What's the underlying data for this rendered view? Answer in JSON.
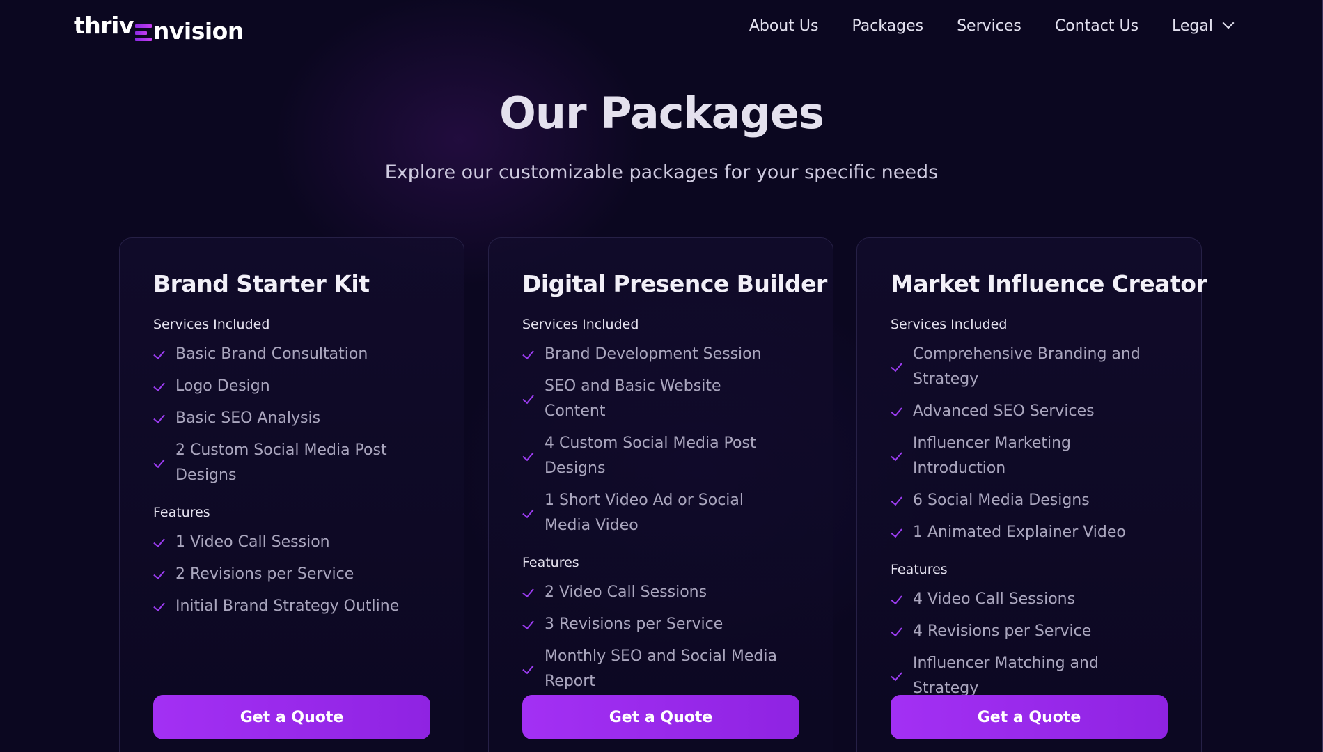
{
  "brand": {
    "logo_left": "thriv",
    "logo_right": "nvision"
  },
  "nav": {
    "items": [
      {
        "label": "About Us"
      },
      {
        "label": "Packages"
      },
      {
        "label": "Services"
      },
      {
        "label": "Contact Us"
      },
      {
        "label": "Legal"
      }
    ]
  },
  "hero": {
    "title": "Our Packages",
    "subtitle": "Explore our customizable packages for your specific needs"
  },
  "packages": [
    {
      "name": "Brand Starter Kit",
      "services_label": "Services Included",
      "services": [
        "Basic Brand Consultation",
        "Logo Design",
        "Basic SEO Analysis",
        "2 Custom Social Media Post Designs"
      ],
      "features_label": "Features",
      "features": [
        "1 Video Call Session",
        "2 Revisions per Service",
        "Initial Brand Strategy Outline"
      ],
      "cta": "Get a Quote"
    },
    {
      "name": "Digital Presence Builder",
      "services_label": "Services Included",
      "services": [
        "Brand Development Session",
        "SEO and Basic Website Content",
        "4 Custom Social Media Post Designs",
        "1 Short Video Ad or Social Media Video"
      ],
      "features_label": "Features",
      "features": [
        "2 Video Call Sessions",
        "3 Revisions per Service",
        "Monthly SEO and Social Media Report"
      ],
      "cta": "Get a Quote"
    },
    {
      "name": "Market Influence Creator",
      "services_label": "Services Included",
      "services": [
        "Comprehensive Branding and Strategy",
        "Advanced SEO Services",
        "Influencer Marketing Introduction",
        "6 Social Media Designs",
        "1 Animated Explainer Video"
      ],
      "features_label": "Features",
      "features": [
        "4 Video Call Sessions",
        "4 Revisions per Service",
        "Influencer Matching and Strategy"
      ],
      "cta": "Get a Quote"
    }
  ],
  "colors": {
    "background": "#0b0720",
    "accent": "#9b3cf0",
    "button": "#a330f4"
  },
  "icons": [
    "check-icon",
    "chevron-down-icon",
    "logo-e-mark-icon"
  ]
}
